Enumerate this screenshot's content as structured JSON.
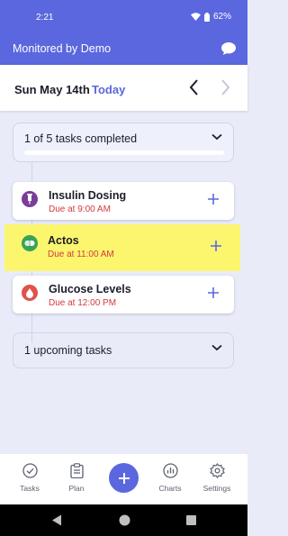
{
  "status_bar": {
    "time": "2:21",
    "battery": "62%"
  },
  "app_bar": {
    "title": "Monitored by Demo"
  },
  "date_bar": {
    "date": "Sun May 14th",
    "today_label": "Today"
  },
  "progress": {
    "text": "1 of 5 tasks completed",
    "completed": 1,
    "total": 5
  },
  "tasks": [
    {
      "name": "Insulin Dosing",
      "due": "Due at 9:00 AM",
      "icon": "syringe-icon",
      "color": "#7a3d9a"
    },
    {
      "name": "Actos",
      "due": "Due at 11:00 AM",
      "icon": "pill-icon",
      "color": "#3aa357",
      "highlighted": true
    },
    {
      "name": "Glucose Levels",
      "due": "Due at 12:00 PM",
      "icon": "blood-drop-icon",
      "color": "#e0524a"
    }
  ],
  "upcoming": {
    "text": "1 upcoming tasks"
  },
  "bottom_nav": [
    {
      "label": "Tasks",
      "icon": "check-circle-icon"
    },
    {
      "label": "Plan",
      "icon": "clipboard-icon"
    },
    {
      "label": "Charts",
      "icon": "chart-icon"
    },
    {
      "label": "Settings",
      "icon": "gear-icon"
    }
  ],
  "colors": {
    "primary": "#5b67de",
    "due": "#d33a3a",
    "highlight": "#fbf66e"
  }
}
